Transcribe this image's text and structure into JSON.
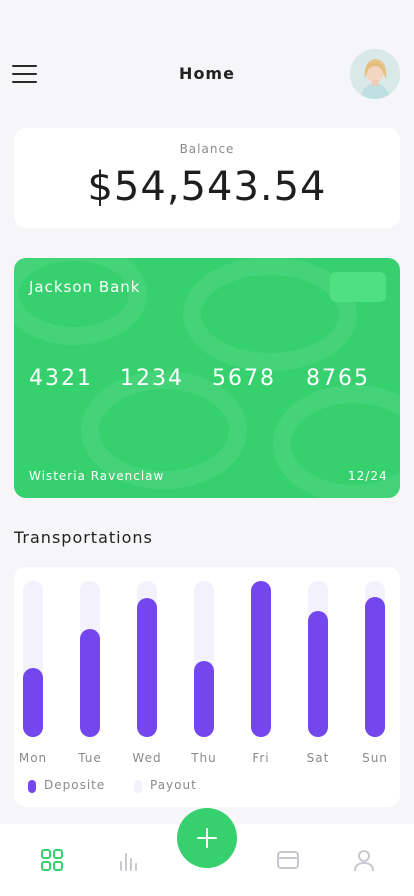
{
  "header": {
    "title": "Home",
    "menu_icon": "hamburger-menu-icon",
    "avatar_icon": "user-avatar"
  },
  "balance": {
    "label": "Balance",
    "amount": "$54,543.54"
  },
  "card": {
    "bank_name": "Jackson Bank",
    "number_groups": [
      "4321",
      "1234",
      "5678",
      "8765"
    ],
    "holder": "Wisteria Ravenclaw",
    "expiry": "12/24",
    "color": "#36d06e"
  },
  "transportations": {
    "title": "Transportations"
  },
  "chart_data": {
    "type": "bar",
    "categories": [
      "Mon",
      "Tue",
      "Wed",
      "Thu",
      "Fri",
      "Sat",
      "Sun"
    ],
    "series": [
      {
        "name": "Deposite",
        "values": [
          44,
          69,
          89,
          49,
          100,
          81,
          90
        ],
        "color": "#7446ee"
      },
      {
        "name": "Payout",
        "values": [
          100,
          100,
          100,
          100,
          100,
          100,
          100
        ],
        "color": "#f3f1fc"
      }
    ],
    "ylim": [
      0,
      100
    ],
    "legend": "bottom-left",
    "grid": false
  },
  "bottom_nav": {
    "items": [
      "grid-icon",
      "bar-chart-icon",
      "card-icon",
      "profile-icon"
    ],
    "fab_icon": "plus-icon",
    "active_color": "#36d06e",
    "inactive_color": "#c9c9cf"
  }
}
